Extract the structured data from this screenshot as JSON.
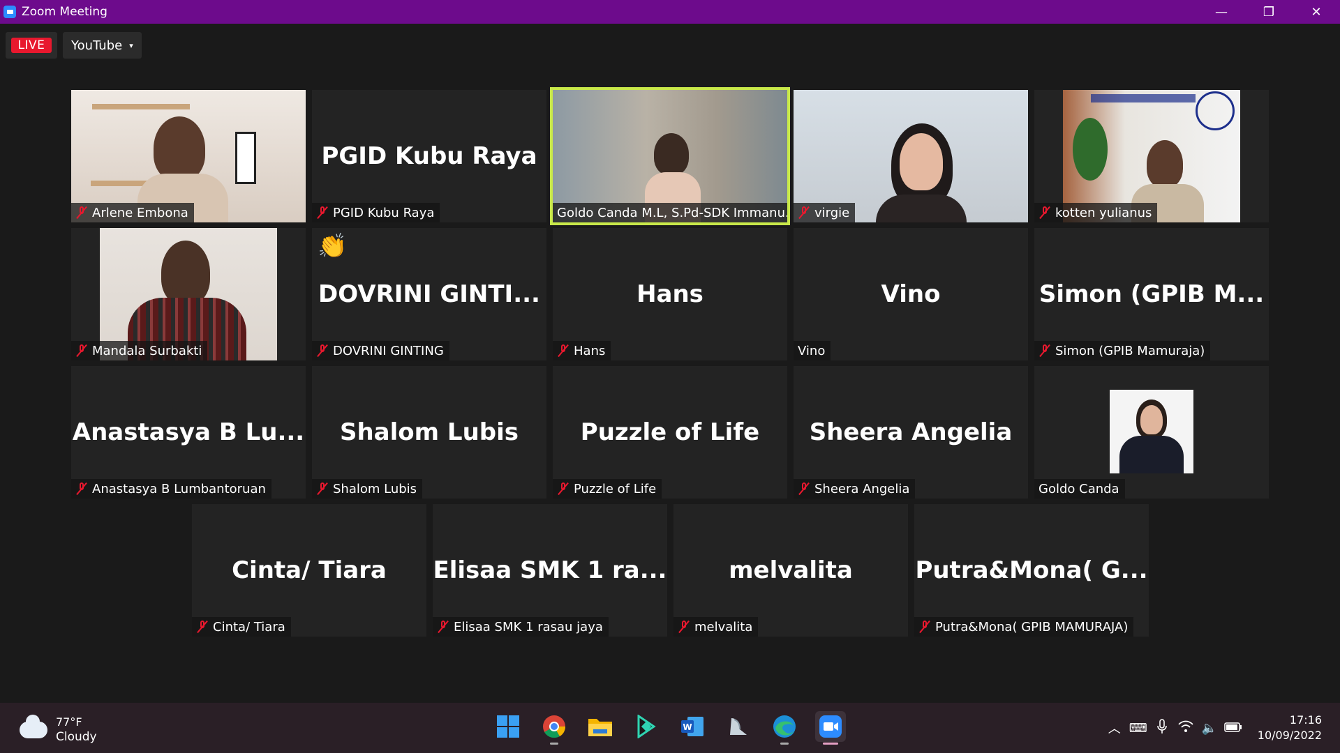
{
  "window": {
    "title": "Zoom Meeting",
    "minimize": "—",
    "restore": "❐",
    "close": "✕"
  },
  "toolbar": {
    "live_label": "LIVE",
    "stream_label": "YouTube",
    "caret": "▾"
  },
  "tiles": [
    {
      "id": "arlene",
      "label": "Arlene Embona",
      "muted": true,
      "type": "video"
    },
    {
      "id": "pgid",
      "label": "PGID Kubu Raya",
      "big": "PGID Kubu Raya",
      "muted": true,
      "type": "name"
    },
    {
      "id": "goldo-active",
      "label": "Goldo Canda M.L, S.Pd-SDK Immanu...",
      "muted": false,
      "type": "video",
      "active": true
    },
    {
      "id": "virgie",
      "label": "virgie",
      "muted": true,
      "type": "video"
    },
    {
      "id": "kotten",
      "label": "kotten yulianus",
      "muted": true,
      "type": "video"
    },
    {
      "id": "mandala",
      "label": "Mandala Surbakti",
      "muted": true,
      "type": "video"
    },
    {
      "id": "dovrini",
      "label": "DOVRINI GINTING",
      "big": "DOVRINI  GINTI...",
      "muted": true,
      "type": "name",
      "emoji": "👏"
    },
    {
      "id": "hans",
      "label": "Hans",
      "big": "Hans",
      "muted": true,
      "type": "name"
    },
    {
      "id": "vino",
      "label": "Vino",
      "big": "Vino",
      "muted": false,
      "type": "name"
    },
    {
      "id": "simon",
      "label": "Simon (GPIB Mamuraja)",
      "big": "Simon  (GPIB  M...",
      "muted": true,
      "type": "name"
    },
    {
      "id": "anastasya",
      "label": "Anastasya B Lumbantoruan",
      "big": "Anastasya  B  Lu...",
      "muted": true,
      "type": "name"
    },
    {
      "id": "shalom",
      "label": "Shalom Lubis",
      "big": "Shalom Lubis",
      "muted": true,
      "type": "name"
    },
    {
      "id": "puzzle",
      "label": "Puzzle of Life",
      "big": "Puzzle of Life",
      "muted": true,
      "type": "name"
    },
    {
      "id": "sheera",
      "label": "Sheera Angelia",
      "big": "Sheera Angelia",
      "muted": true,
      "type": "name"
    },
    {
      "id": "goldo",
      "label": "Goldo Canda",
      "muted": false,
      "type": "photo"
    },
    {
      "id": "cinta",
      "label": "Cinta/ Tiara",
      "big": "Cinta/ Tiara",
      "muted": true,
      "type": "name"
    },
    {
      "id": "elisaa",
      "label": "Elisaa SMK 1 rasau jaya",
      "big": "Elisaa  SMK  1  ra...",
      "muted": true,
      "type": "name"
    },
    {
      "id": "melvalita",
      "label": "melvalita",
      "big": "melvalita",
      "muted": true,
      "type": "name"
    },
    {
      "id": "putra",
      "label": "Putra&Mona( GPIB MAMURAJA)",
      "big": "Putra&Mona(  G...",
      "muted": true,
      "type": "name"
    }
  ],
  "taskbar": {
    "weather": {
      "temp": "77°F",
      "condition": "Cloudy"
    },
    "apps": [
      "windows-start-icon",
      "chrome-icon",
      "file-explorer-icon",
      "filmora-icon",
      "word-icon",
      "app-icon",
      "edge-icon",
      "zoom-icon"
    ],
    "clock": {
      "time": "17:16",
      "date": "10/09/2022"
    }
  },
  "colors": {
    "titlebar": "#6d0b8c",
    "live": "#e8182e",
    "active_border": "#c8e84a",
    "tile_bg": "#232323"
  }
}
